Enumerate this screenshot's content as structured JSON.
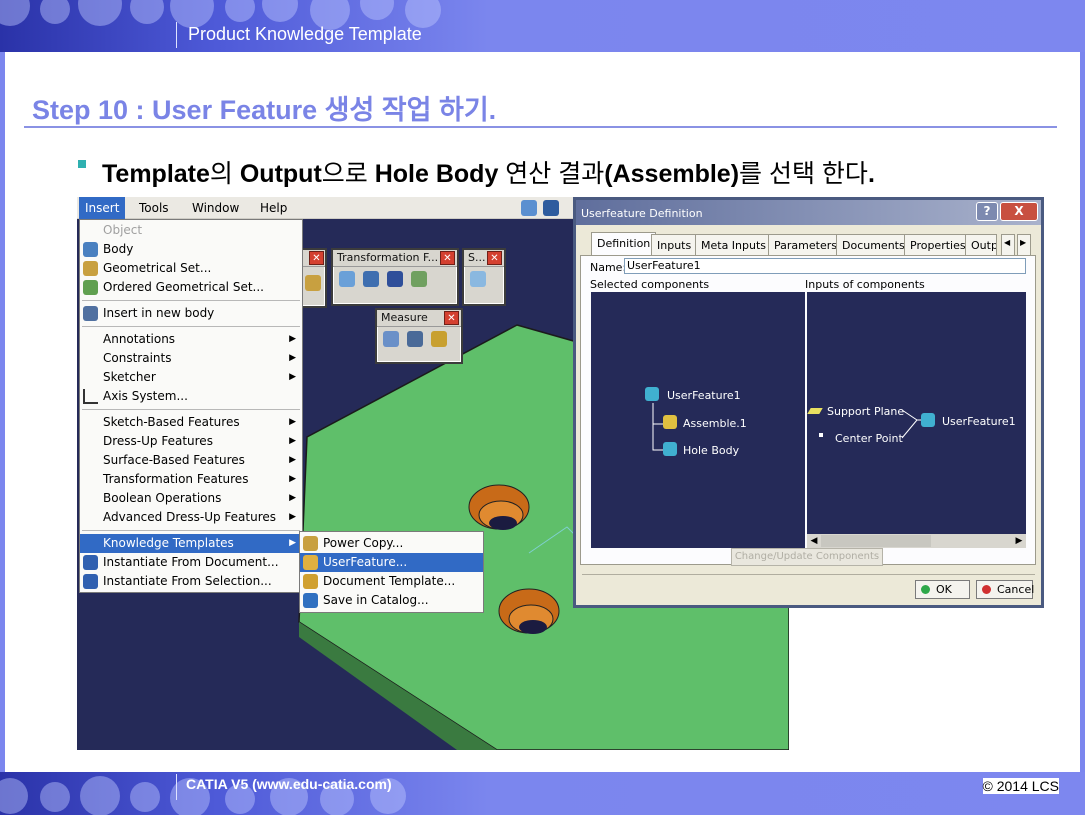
{
  "header": {
    "title": "Product Knowledge Template"
  },
  "slide": {
    "step_title": "Step 10 : User Feature 생성 작업 하기.",
    "bullet": {
      "p1": "Template",
      "p2": "의 ",
      "p3": "Output",
      "p4": "으로 ",
      "p5": "Hole Body",
      "p6": " 연산 결과",
      "p7": "(Assemble)",
      "p8": "를 선택 한다",
      "p9": "."
    }
  },
  "footer": {
    "left": "CATIA V5 (www.edu-catia.com)",
    "right": "© 2014 LCS"
  },
  "menubar": {
    "insert": "Insert",
    "tools": "Tools",
    "window": "Window",
    "help": "Help"
  },
  "toolbars": {
    "transformation": "Transformation F...",
    "s": "S...",
    "measure": "Measure"
  },
  "insert_menu": [
    {
      "label": "Object",
      "dim": true
    },
    {
      "label": "Body"
    },
    {
      "label": "Geometrical Set..."
    },
    {
      "label": "Ordered Geometrical Set..."
    },
    {
      "label": "Insert in new body"
    },
    {
      "label": "Annotations",
      "submenu": true
    },
    {
      "label": "Constraints",
      "submenu": true
    },
    {
      "label": "Sketcher",
      "submenu": true
    },
    {
      "label": "Axis System..."
    },
    {
      "label": "Sketch-Based Features",
      "submenu": true
    },
    {
      "label": "Dress-Up Features",
      "submenu": true
    },
    {
      "label": "Surface-Based Features",
      "submenu": true
    },
    {
      "label": "Transformation Features",
      "submenu": true
    },
    {
      "label": "Boolean Operations",
      "submenu": true
    },
    {
      "label": "Advanced Dress-Up Features",
      "submenu": true
    },
    {
      "label": "Knowledge Templates",
      "submenu": true,
      "highlighted": true
    },
    {
      "label": "Instantiate From Document..."
    },
    {
      "label": "Instantiate From Selection..."
    }
  ],
  "knowledge_menu": [
    {
      "label": "Power Copy..."
    },
    {
      "label": "UserFeature...",
      "highlighted": true
    },
    {
      "label": "Document Template..."
    },
    {
      "label": "Save in Catalog..."
    }
  ],
  "dialog": {
    "title": "Userfeature Definition",
    "help_btn": "?",
    "close_btn": "X",
    "tabs": [
      "Definition",
      "Inputs",
      "Meta Inputs",
      "Parameters",
      "Documents",
      "Properties",
      "Outp"
    ],
    "name_label": "Name:",
    "name_value": "UserFeature1",
    "selected_header": "Selected components",
    "inputs_header": "Inputs of components",
    "tree_root": "UserFeature1",
    "tree_child1": "Assemble.1",
    "tree_child2": "Hole Body",
    "input1": "Support Plane",
    "input2": "Center Point",
    "input_target": "UserFeature1",
    "change_btn": "Change/Update Components",
    "ok": "OK",
    "cancel": "Cancel"
  },
  "colors": {
    "banner": "#7b86ee",
    "title": "#7a84e6",
    "plate": "#5fbf6a",
    "viewport": "#252a58",
    "highlight": "#316ac5"
  }
}
